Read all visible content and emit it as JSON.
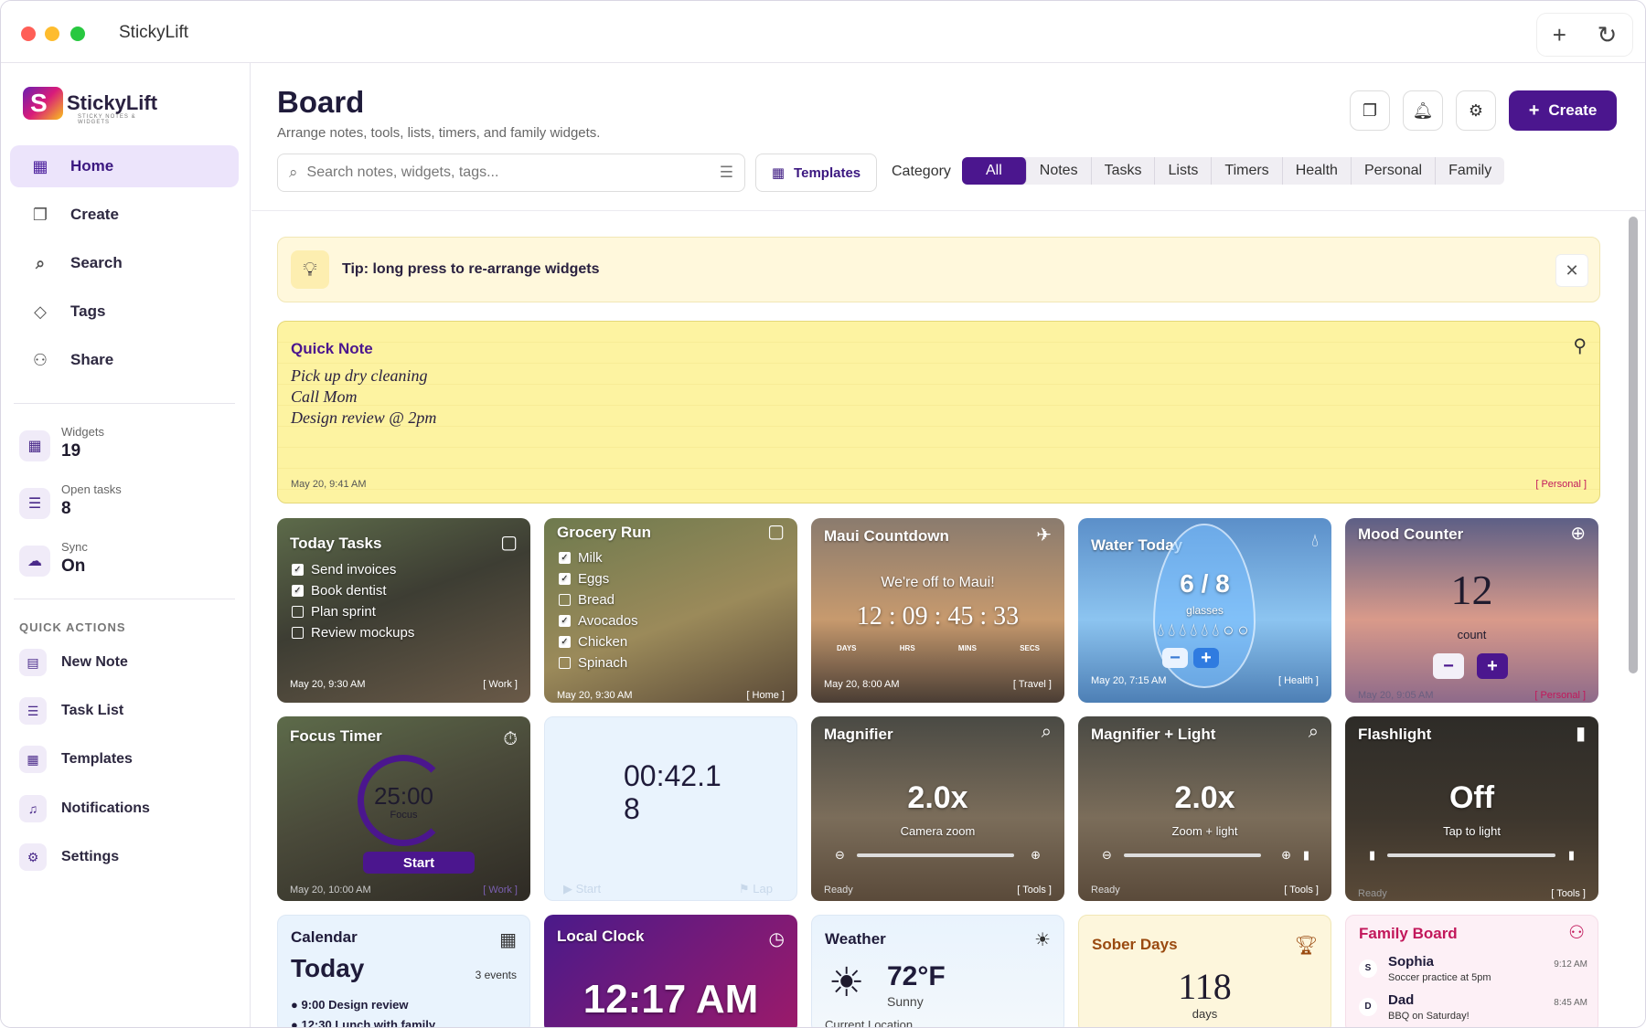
{
  "window": {
    "title": "StickyLift",
    "actions": [
      "+",
      "↻"
    ]
  },
  "sidebar": {
    "logo_text": "StickyLift",
    "logo_sub": "STICKY NOTES & WIDGETS",
    "nav": [
      {
        "label": "Home",
        "icon": "grid-icon"
      },
      {
        "label": "Create",
        "icon": "copy-icon"
      },
      {
        "label": "Search",
        "icon": "search-icon"
      },
      {
        "label": "Tags",
        "icon": "tag-icon"
      },
      {
        "label": "Share",
        "icon": "users-icon"
      }
    ],
    "stats": [
      {
        "label": "Widgets",
        "value": "19"
      },
      {
        "label": "Open tasks",
        "value": "8"
      },
      {
        "label": "Sync",
        "value": "On"
      }
    ],
    "quick_actions_title": "QUICK ACTIONS",
    "quick_actions": [
      {
        "label": "New Note"
      },
      {
        "label": "Task List"
      },
      {
        "label": "Templates"
      },
      {
        "label": "Notifications"
      },
      {
        "label": "Settings"
      }
    ]
  },
  "header": {
    "title": "Board",
    "subtitle": "Arrange notes, tools, lists, timers, and family widgets.",
    "create_label": "Create",
    "search_placeholder": "Search notes, widgets, tags...",
    "templates_label": "Templates",
    "category_label": "Category",
    "categories": [
      "All",
      "Notes",
      "Tasks",
      "Lists",
      "Timers",
      "Health",
      "Personal",
      "Family"
    ]
  },
  "tip": {
    "text": "Tip: long press to re-arrange widgets"
  },
  "quick_note": {
    "title": "Quick Note",
    "lines": [
      "Pick up dry cleaning",
      "Call Mom",
      "Design review @ 2pm"
    ],
    "date": "May 20, 9:41 AM",
    "tag": "[ Personal ]"
  },
  "widgets": {
    "today_tasks": {
      "title": "Today Tasks",
      "items": [
        {
          "text": "Send invoices",
          "done": true
        },
        {
          "text": "Book dentist",
          "done": true
        },
        {
          "text": "Plan sprint",
          "done": false
        },
        {
          "text": "Review mockups",
          "done": false
        }
      ],
      "date": "May 20, 9:30 AM",
      "tag": "[ Work ]"
    },
    "grocery": {
      "title": "Grocery Run",
      "items": [
        {
          "text": "Milk",
          "done": true
        },
        {
          "text": "Eggs",
          "done": true
        },
        {
          "text": "Bread",
          "done": false
        },
        {
          "text": "Avocados",
          "done": true
        },
        {
          "text": "Chicken",
          "done": true
        },
        {
          "text": "Spinach",
          "done": false
        }
      ],
      "date": "May 20, 9:30 AM",
      "tag": "[ Home ]"
    },
    "maui": {
      "title": "Maui Countdown",
      "subtitle": "We're off to Maui!",
      "time": "12 : 09 : 45 : 33",
      "units": [
        "DAYS",
        "HRS",
        "MINS",
        "SECS"
      ],
      "date": "May 20, 8:00 AM",
      "tag": "[ Travel ]"
    },
    "water": {
      "title": "Water Today",
      "count": "6 / 8",
      "unit": "glasses",
      "date": "May 20, 7:15 AM",
      "tag": "[ Health ]"
    },
    "mood": {
      "title": "Mood Counter",
      "count": "12",
      "unit": "count",
      "date": "May 20, 9:05 AM",
      "tag": "[ Personal ]"
    },
    "focus": {
      "title": "Focus Timer",
      "time": "25:00",
      "label": "Focus",
      "button": "Start",
      "date": "May 20, 10:00 AM",
      "tag": "[ Work ]"
    },
    "stopwatch": {
      "time": "00:42.1",
      "line2": "8",
      "start": "Start",
      "lap": "Lap"
    },
    "magnifier": {
      "title": "Magnifier",
      "value": "2.0x",
      "label": "Camera zoom",
      "status": "Ready",
      "tag": "[ Tools ]"
    },
    "magnifier_light": {
      "title": "Magnifier + Light",
      "value": "2.0x",
      "label": "Zoom + light",
      "status": "Ready",
      "tag": "[ Tools ]"
    },
    "flashlight": {
      "title": "Flashlight",
      "value": "Off",
      "label": "Tap to light",
      "status": "Ready",
      "tag": "[ Tools ]"
    },
    "calendar": {
      "title": "Calendar",
      "day": "Today",
      "count": "3 events",
      "events": [
        "9:00 Design review",
        "12:30 Lunch with family"
      ]
    },
    "clock": {
      "title": "Local Clock",
      "time": "12:17 AM"
    },
    "weather": {
      "title": "Weather",
      "temp": "72°F",
      "cond": "Sunny",
      "loc": "Current Location"
    },
    "sober": {
      "title": "Sober Days",
      "count": "118",
      "unit": "days"
    },
    "family": {
      "title": "Family Board",
      "posts": [
        {
          "initial": "S",
          "name": "Sophia",
          "text": "Soccer practice at 5pm",
          "time": "9:12 AM"
        },
        {
          "initial": "D",
          "name": "Dad",
          "text": "BBQ on Saturday!",
          "time": "8:45 AM"
        }
      ]
    }
  },
  "colors": {
    "accent": "#4b168e",
    "note_bg": "#fdf3a1",
    "tag_pink": "#c2185b"
  }
}
